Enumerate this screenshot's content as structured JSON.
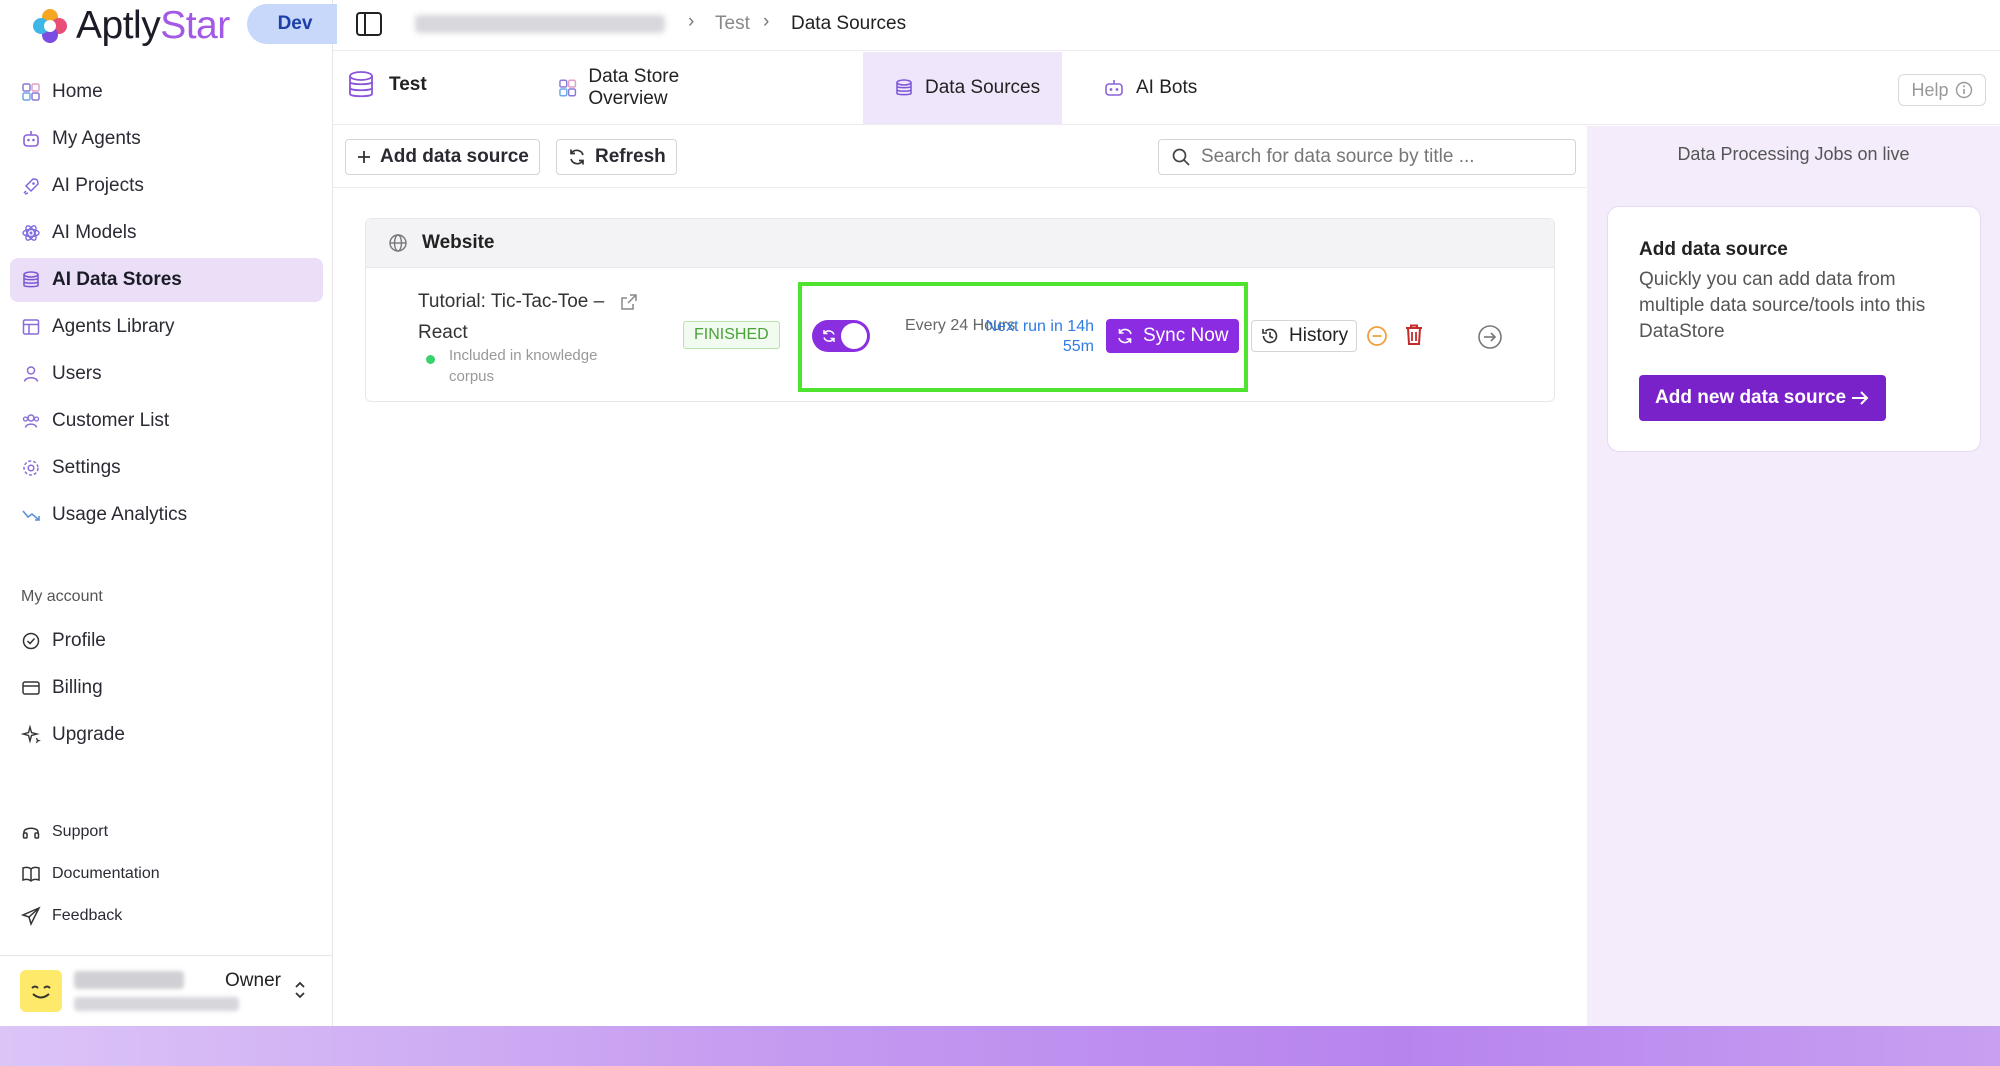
{
  "brand": {
    "name_main": "Aptly",
    "name_accent": "Star",
    "env_badge": "Dev"
  },
  "sidebar": {
    "items": [
      {
        "label": "Home",
        "icon": "home-grid-icon"
      },
      {
        "label": "My Agents",
        "icon": "robot-icon"
      },
      {
        "label": "AI Projects",
        "icon": "rocket-icon"
      },
      {
        "label": "AI Models",
        "icon": "atom-icon"
      },
      {
        "label": "AI Data Stores",
        "icon": "database-icon",
        "active": true
      },
      {
        "label": "Agents Library",
        "icon": "library-icon"
      },
      {
        "label": "Users",
        "icon": "user-icon"
      },
      {
        "label": "Customer List",
        "icon": "customers-icon"
      },
      {
        "label": "Settings",
        "icon": "gear-icon"
      },
      {
        "label": "Usage Analytics",
        "icon": "analytics-icon"
      }
    ],
    "account_section_title": "My account",
    "account_items": [
      {
        "label": "Profile",
        "icon": "profile-check-icon"
      },
      {
        "label": "Billing",
        "icon": "credit-card-icon"
      },
      {
        "label": "Upgrade",
        "icon": "sparkle-icon"
      }
    ],
    "footer_items": [
      {
        "label": "Support",
        "icon": "headset-icon"
      },
      {
        "label": "Documentation",
        "icon": "book-icon"
      },
      {
        "label": "Feedback",
        "icon": "send-icon"
      }
    ],
    "user": {
      "role": "Owner"
    }
  },
  "breadcrumb": {
    "items": [
      "Test",
      "Data Sources"
    ]
  },
  "datastore": {
    "name": "Test"
  },
  "tabs": [
    {
      "label": "Data Store Overview",
      "icon": "overview-icon"
    },
    {
      "label": "Data Sources",
      "icon": "database-icon",
      "active": true
    },
    {
      "label": "AI Bots",
      "icon": "bot-icon"
    }
  ],
  "help": {
    "label": "Help"
  },
  "toolbar": {
    "add_label": "Add data source",
    "refresh_label": "Refresh",
    "search_placeholder": "Search for data source by title ..."
  },
  "source_group": {
    "title": "Website",
    "source": {
      "title": "Tutorial: Tic-Tac-Toe – React",
      "status_text": "Included in knowledge corpus",
      "badge": "FINISHED",
      "auto_sync_enabled": true,
      "schedule": "Every 24 Hours",
      "next_run": "Next run in 14h 55m",
      "sync_label": "Sync Now",
      "history_label": "History"
    }
  },
  "right_panel": {
    "title": "Data Processing Jobs on live",
    "card_title": "Add data source",
    "card_desc": "Quickly you can add data from multiple data source/tools into this DataStore",
    "card_button": "Add new data source"
  },
  "colors": {
    "accent": "#8b2be2",
    "active_bg": "#eadff7",
    "highlight": "#4ee32f",
    "success": "#4aa23a",
    "link": "#2f7de1"
  }
}
